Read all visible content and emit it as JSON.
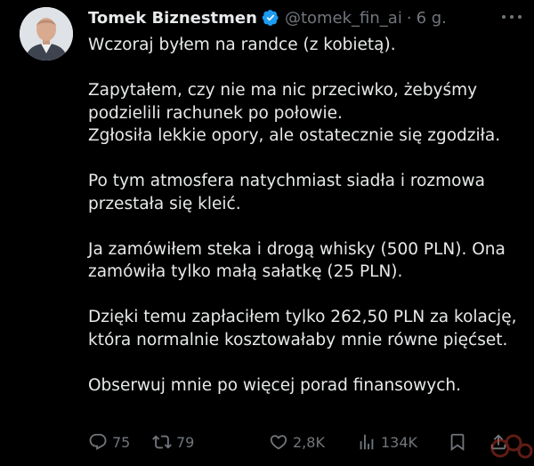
{
  "tweet": {
    "author_name": "Tomek Biznestmen",
    "handle": "@tomek_fin_ai",
    "separator": "·",
    "time": "6 g.",
    "paragraphs": [
      [
        "Wczoraj byłem na randce (z kobietą)."
      ],
      [
        "Zapytałem, czy nie ma nic przeciwko, żebyśmy",
        "podzielili rachunek po połowie.",
        "Zgłosiła lekkie opory, ale ostatecznie się zgodziła."
      ],
      [
        "Po tym atmosfera natychmiast siadła i rozmowa",
        "przestała się kleić."
      ],
      [
        "Ja zamówiłem steka i drogą whisky (500 PLN). Ona",
        "zamówiła tylko małą sałatkę (25 PLN)."
      ],
      [
        "Dzięki temu zapłaciłem tylko 262,50 PLN za kolację,",
        "która normalnie kosztowałaby mnie równe pięćset."
      ],
      [
        "Obserwuj mnie po więcej porad finansowych."
      ]
    ]
  },
  "actions": {
    "replies": "75",
    "retweets": "79",
    "likes": "2,8K",
    "views": "134K"
  },
  "icons": {
    "verified": "verified-badge-icon",
    "reply": "reply-icon",
    "retweet": "retweet-icon",
    "like": "heart-icon",
    "views": "views-icon",
    "bookmark": "bookmark-icon",
    "share": "share-icon",
    "more": "more-icon"
  },
  "colors": {
    "background": "#000000",
    "text": "#e7e9ea",
    "muted": "#71767b",
    "verified": "#1d9bf0"
  }
}
